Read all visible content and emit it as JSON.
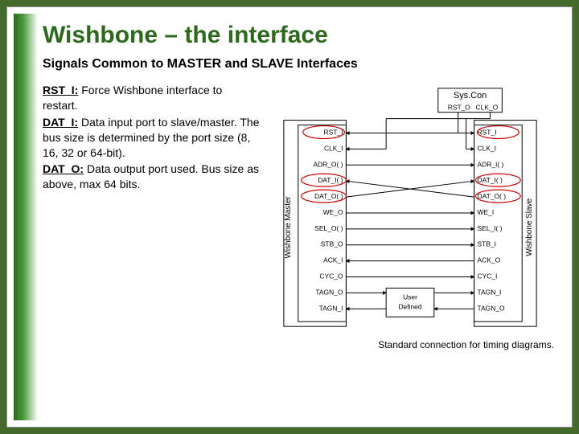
{
  "title": "Wishbone – the interface",
  "subtitle": "Signals Common to MASTER and SLAVE Interfaces",
  "desc": {
    "rst_name": "RST_I:",
    "rst_text": " Force Wishbone interface to restart.",
    "dati_name": "DAT_I:",
    "dati_text": " Data input port to slave/master. The bus size is determined by the port size (8, 16, 32 or 64-bit).",
    "dato_name": "DAT_O:",
    "dato_text": " Data output port used. Bus size as above, max 64 bits."
  },
  "diagram": {
    "syscon": "Sys.Con",
    "syscon_out": [
      "RST_O",
      "CLK_O"
    ],
    "master_label": "Wishbone Master",
    "slave_label": "Wishbone Slave",
    "master_signals": [
      "RST_I",
      "CLK_I",
      "ADR_O( )",
      "DAT_I( )",
      "DAT_O( )",
      "WE_O",
      "SEL_O( )",
      "STB_O",
      "ACK_I",
      "CYC_O",
      "TAGN_O",
      "TAGN_I"
    ],
    "slave_signals": [
      "RST_I",
      "CLK_I",
      "ADR_I( )",
      "DAT_I( )",
      "DAT_O( )",
      "WE_I",
      "SEL_I( )",
      "STB_I",
      "ACK_O",
      "CYC_I",
      "TAGN_I",
      "TAGN_O"
    ],
    "user_defined": "User\nDefined"
  },
  "caption": "Standard connection for timing diagrams."
}
